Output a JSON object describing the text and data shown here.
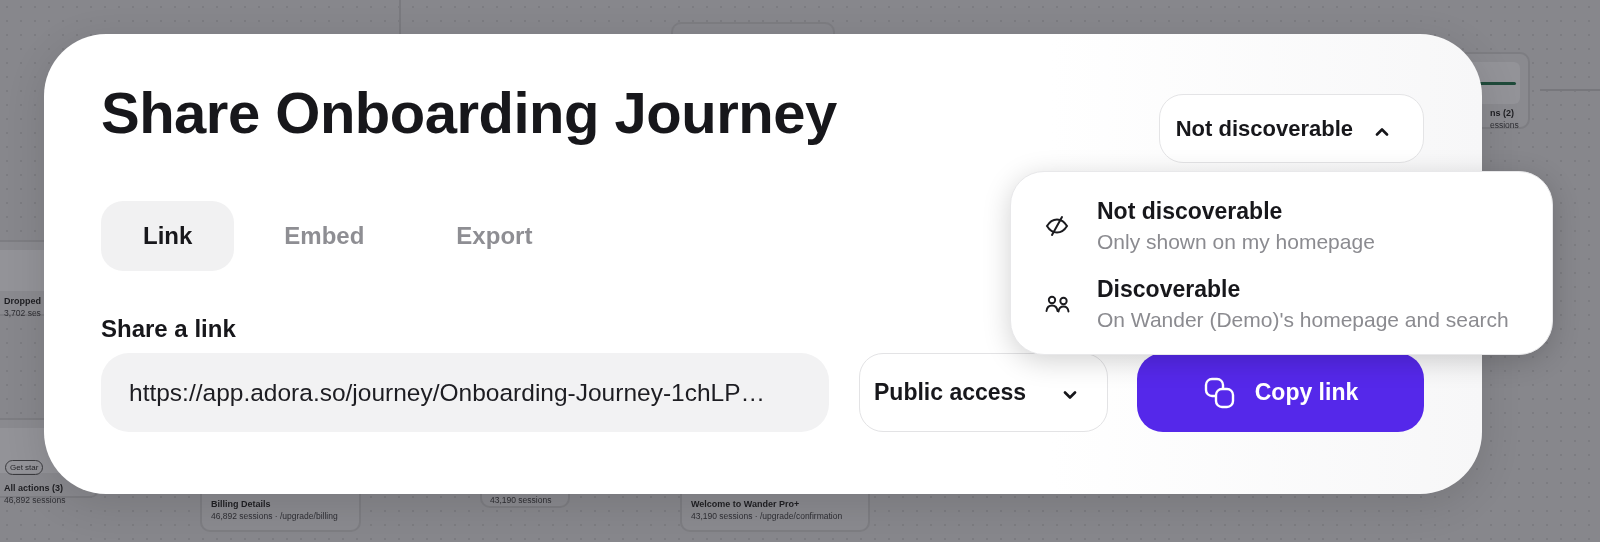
{
  "background_canvas": {
    "nodes": [
      {
        "title": "Dropped",
        "subtitle": "3,702 ses"
      },
      {
        "button": "Get star",
        "title": "All actions (3)",
        "subtitle": "46,892 sessions"
      },
      {
        "title": "Billing Details",
        "subtitle": "46,892 sessions · /upgrade/billing"
      },
      {
        "subtitle": "43,190 sessions"
      },
      {
        "title": "Welcome to Wander Pro+",
        "subtitle": "43,190 sessions · /upgrade/confirmation"
      },
      {
        "title": "ns (2)",
        "subtitle": "essions"
      }
    ]
  },
  "dialog": {
    "title": "Share Onboarding Journey",
    "visibility_select": {
      "value": "Not discoverable",
      "expanded": true
    },
    "visibility_menu": [
      {
        "kind": "hidden",
        "title": "Not discoverable",
        "description": "Only shown on my homepage"
      },
      {
        "kind": "people",
        "title": "Discoverable",
        "description": "On Wander (Demo)'s homepage and search"
      }
    ],
    "tabs": [
      {
        "label": "Link",
        "selected": true
      },
      {
        "label": "Embed",
        "selected": false
      },
      {
        "label": "Export",
        "selected": false
      }
    ],
    "share_link": {
      "label": "Share a link",
      "url": "https://app.adora.so/journey/Onboarding-Journey-1chLP…",
      "access_select": {
        "value": "Public access"
      },
      "copy_button": "Copy link"
    }
  }
}
